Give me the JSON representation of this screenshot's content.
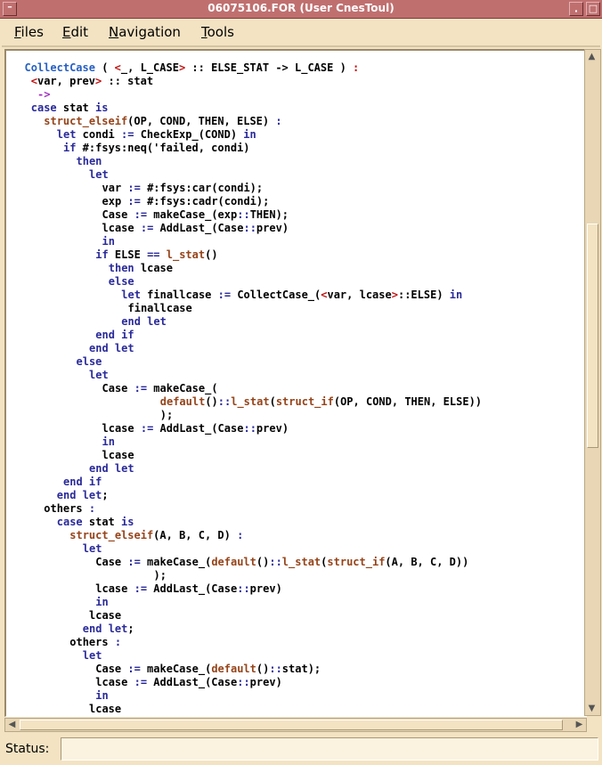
{
  "window": {
    "title": "06075106.FOR (User CnesToul)"
  },
  "menu": [
    {
      "label": "Files",
      "mnemonic": "F",
      "rest": "iles"
    },
    {
      "label": "Edit",
      "mnemonic": "E",
      "rest": "dit"
    },
    {
      "label": "Navigation",
      "mnemonic": "N",
      "rest": "avigation"
    },
    {
      "label": "Tools",
      "mnemonic": "T",
      "rest": "ools"
    }
  ],
  "code_lines": [
    {
      "indent": 2,
      "parts": [
        {
          "t": "CollectCase",
          "c": "c"
        },
        {
          "t": " ( "
        },
        {
          "t": "<",
          "c": "r"
        },
        {
          "t": "_, L_CASE"
        },
        {
          "t": ">",
          "c": "r"
        },
        {
          "t": " :: ELSE_STAT -> L_CASE ) "
        },
        {
          "t": ":",
          "c": "r"
        }
      ]
    },
    {
      "indent": 3,
      "parts": [
        {
          "t": "<",
          "c": "r"
        },
        {
          "t": "var, prev"
        },
        {
          "t": ">",
          "c": "r"
        },
        {
          "t": " :: stat"
        }
      ]
    },
    {
      "indent": 4,
      "parts": [
        {
          "t": "->",
          "c": "p"
        }
      ]
    },
    {
      "indent": 3,
      "parts": [
        {
          "t": "case",
          "c": "k"
        },
        {
          "t": " stat "
        },
        {
          "t": "is",
          "c": "k"
        }
      ]
    },
    {
      "indent": 5,
      "parts": [
        {
          "t": "struct_elseif",
          "c": "f"
        },
        {
          "t": "(OP, COND, THEN, ELSE) "
        },
        {
          "t": ":",
          "c": "k"
        }
      ]
    },
    {
      "indent": 7,
      "parts": [
        {
          "t": "let",
          "c": "k"
        },
        {
          "t": " condi "
        },
        {
          "t": ":=",
          "c": "k"
        },
        {
          "t": " CheckExp_(COND) "
        },
        {
          "t": "in",
          "c": "k"
        }
      ]
    },
    {
      "indent": 8,
      "parts": [
        {
          "t": "if",
          "c": "k"
        },
        {
          "t": " #:fsys:neq('failed, condi)"
        }
      ]
    },
    {
      "indent": 10,
      "parts": [
        {
          "t": "then",
          "c": "k"
        }
      ]
    },
    {
      "indent": 12,
      "parts": [
        {
          "t": "let",
          "c": "k"
        }
      ]
    },
    {
      "indent": 14,
      "parts": [
        {
          "t": "var "
        },
        {
          "t": ":=",
          "c": "k"
        },
        {
          "t": " #:fsys:car(condi);"
        }
      ]
    },
    {
      "indent": 14,
      "parts": [
        {
          "t": "exp "
        },
        {
          "t": ":=",
          "c": "k"
        },
        {
          "t": " #:fsys:cadr(condi);"
        }
      ]
    },
    {
      "indent": 14,
      "parts": [
        {
          "t": "Case "
        },
        {
          "t": ":=",
          "c": "k"
        },
        {
          "t": " makeCase_(exp"
        },
        {
          "t": "::",
          "c": "k"
        },
        {
          "t": "THEN);"
        }
      ]
    },
    {
      "indent": 14,
      "parts": [
        {
          "t": "lcase "
        },
        {
          "t": ":=",
          "c": "k"
        },
        {
          "t": " AddLast_(Case"
        },
        {
          "t": "::",
          "c": "k"
        },
        {
          "t": "prev)"
        }
      ]
    },
    {
      "indent": 14,
      "parts": [
        {
          "t": "in",
          "c": "k"
        }
      ]
    },
    {
      "indent": 13,
      "parts": [
        {
          "t": "if",
          "c": "k"
        },
        {
          "t": " ELSE "
        },
        {
          "t": "==",
          "c": "k"
        },
        {
          "t": " "
        },
        {
          "t": "l_stat",
          "c": "f"
        },
        {
          "t": "()"
        }
      ]
    },
    {
      "indent": 15,
      "parts": [
        {
          "t": "then",
          "c": "k"
        },
        {
          "t": " lcase"
        }
      ]
    },
    {
      "indent": 15,
      "parts": [
        {
          "t": "else",
          "c": "k"
        }
      ]
    },
    {
      "indent": 17,
      "parts": [
        {
          "t": "let",
          "c": "k"
        },
        {
          "t": " finallcase "
        },
        {
          "t": ":=",
          "c": "k"
        },
        {
          "t": " CollectCase_("
        },
        {
          "t": "<",
          "c": "r"
        },
        {
          "t": "var, lcase"
        },
        {
          "t": ">",
          "c": "r"
        },
        {
          "t": "::ELSE) "
        },
        {
          "t": "in",
          "c": "k"
        }
      ]
    },
    {
      "indent": 18,
      "parts": [
        {
          "t": "finallcase"
        }
      ]
    },
    {
      "indent": 17,
      "parts": [
        {
          "t": "end let",
          "c": "k"
        }
      ]
    },
    {
      "indent": 13,
      "parts": [
        {
          "t": "end if",
          "c": "k"
        }
      ]
    },
    {
      "indent": 12,
      "parts": [
        {
          "t": "end let",
          "c": "k"
        }
      ]
    },
    {
      "indent": 10,
      "parts": [
        {
          "t": "else",
          "c": "k"
        }
      ]
    },
    {
      "indent": 12,
      "parts": [
        {
          "t": "let",
          "c": "k"
        }
      ]
    },
    {
      "indent": 14,
      "parts": [
        {
          "t": "Case "
        },
        {
          "t": ":=",
          "c": "k"
        },
        {
          "t": " makeCase_("
        }
      ]
    },
    {
      "indent": 23,
      "parts": [
        {
          "t": "default",
          "c": "f"
        },
        {
          "t": "()"
        },
        {
          "t": "::",
          "c": "k"
        },
        {
          "t": "l_stat",
          "c": "f"
        },
        {
          "t": "("
        },
        {
          "t": "struct_if",
          "c": "f"
        },
        {
          "t": "(OP, COND, THEN, ELSE))"
        }
      ]
    },
    {
      "indent": 23,
      "parts": [
        {
          "t": ");"
        }
      ]
    },
    {
      "indent": 14,
      "parts": [
        {
          "t": "lcase "
        },
        {
          "t": ":=",
          "c": "k"
        },
        {
          "t": " AddLast_(Case"
        },
        {
          "t": "::",
          "c": "k"
        },
        {
          "t": "prev)"
        }
      ]
    },
    {
      "indent": 14,
      "parts": [
        {
          "t": "in",
          "c": "k"
        }
      ]
    },
    {
      "indent": 14,
      "parts": [
        {
          "t": "lcase"
        }
      ]
    },
    {
      "indent": 12,
      "parts": [
        {
          "t": "end let",
          "c": "k"
        }
      ]
    },
    {
      "indent": 8,
      "parts": [
        {
          "t": "end if",
          "c": "k"
        }
      ]
    },
    {
      "indent": 7,
      "parts": [
        {
          "t": "end let",
          "c": "k"
        },
        {
          "t": ";"
        }
      ]
    },
    {
      "indent": 5,
      "parts": [
        {
          "t": "others "
        },
        {
          "t": ":",
          "c": "k"
        }
      ]
    },
    {
      "indent": 7,
      "parts": [
        {
          "t": "case",
          "c": "k"
        },
        {
          "t": " stat "
        },
        {
          "t": "is",
          "c": "k"
        }
      ]
    },
    {
      "indent": 9,
      "parts": [
        {
          "t": "struct_elseif",
          "c": "f"
        },
        {
          "t": "(A, B, C, D) "
        },
        {
          "t": ":",
          "c": "k"
        }
      ]
    },
    {
      "indent": 11,
      "parts": [
        {
          "t": "let",
          "c": "k"
        }
      ]
    },
    {
      "indent": 13,
      "parts": [
        {
          "t": "Case "
        },
        {
          "t": ":=",
          "c": "k"
        },
        {
          "t": " makeCase_("
        },
        {
          "t": "default",
          "c": "f"
        },
        {
          "t": "()"
        },
        {
          "t": "::",
          "c": "k"
        },
        {
          "t": "l_stat",
          "c": "f"
        },
        {
          "t": "("
        },
        {
          "t": "struct_if",
          "c": "f"
        },
        {
          "t": "(A, B, C, D))"
        }
      ]
    },
    {
      "indent": 22,
      "parts": [
        {
          "t": ");"
        }
      ]
    },
    {
      "indent": 13,
      "parts": [
        {
          "t": "lcase "
        },
        {
          "t": ":=",
          "c": "k"
        },
        {
          "t": " AddLast_(Case"
        },
        {
          "t": "::",
          "c": "k"
        },
        {
          "t": "prev)"
        }
      ]
    },
    {
      "indent": 13,
      "parts": [
        {
          "t": "in",
          "c": "k"
        }
      ]
    },
    {
      "indent": 12,
      "parts": [
        {
          "t": "lcase"
        }
      ]
    },
    {
      "indent": 11,
      "parts": [
        {
          "t": "end let",
          "c": "k"
        },
        {
          "t": ";"
        }
      ]
    },
    {
      "indent": 9,
      "parts": [
        {
          "t": "others "
        },
        {
          "t": ":",
          "c": "k"
        }
      ]
    },
    {
      "indent": 11,
      "parts": [
        {
          "t": "let",
          "c": "k"
        }
      ]
    },
    {
      "indent": 13,
      "parts": [
        {
          "t": "Case "
        },
        {
          "t": ":=",
          "c": "k"
        },
        {
          "t": " makeCase_("
        },
        {
          "t": "default",
          "c": "f"
        },
        {
          "t": "()"
        },
        {
          "t": "::",
          "c": "k"
        },
        {
          "t": "stat);"
        }
      ]
    },
    {
      "indent": 13,
      "parts": [
        {
          "t": "lcase "
        },
        {
          "t": ":=",
          "c": "k"
        },
        {
          "t": " AddLast_(Case"
        },
        {
          "t": "::",
          "c": "k"
        },
        {
          "t": "prev)"
        }
      ]
    },
    {
      "indent": 13,
      "parts": [
        {
          "t": "in",
          "c": "k"
        }
      ]
    },
    {
      "indent": 12,
      "parts": [
        {
          "t": "lcase"
        }
      ]
    }
  ],
  "status": {
    "label": "Status:",
    "value": ""
  },
  "colors": {
    "title_bar": "#c06f6f",
    "window_bg": "#f3e3c3",
    "keyword": "#2a2a9a",
    "function": "#96441a",
    "definition": "#2760c2",
    "bracket": "#c01010",
    "arrow": "#a030c0"
  },
  "icons": {
    "title_left": "window-menu-icon",
    "minimize": "minimize-icon",
    "maximize": "maximize-icon",
    "scroll_up": "arrow-up-icon",
    "scroll_down": "arrow-down-icon",
    "scroll_left": "arrow-left-icon",
    "scroll_right": "arrow-right-icon"
  }
}
